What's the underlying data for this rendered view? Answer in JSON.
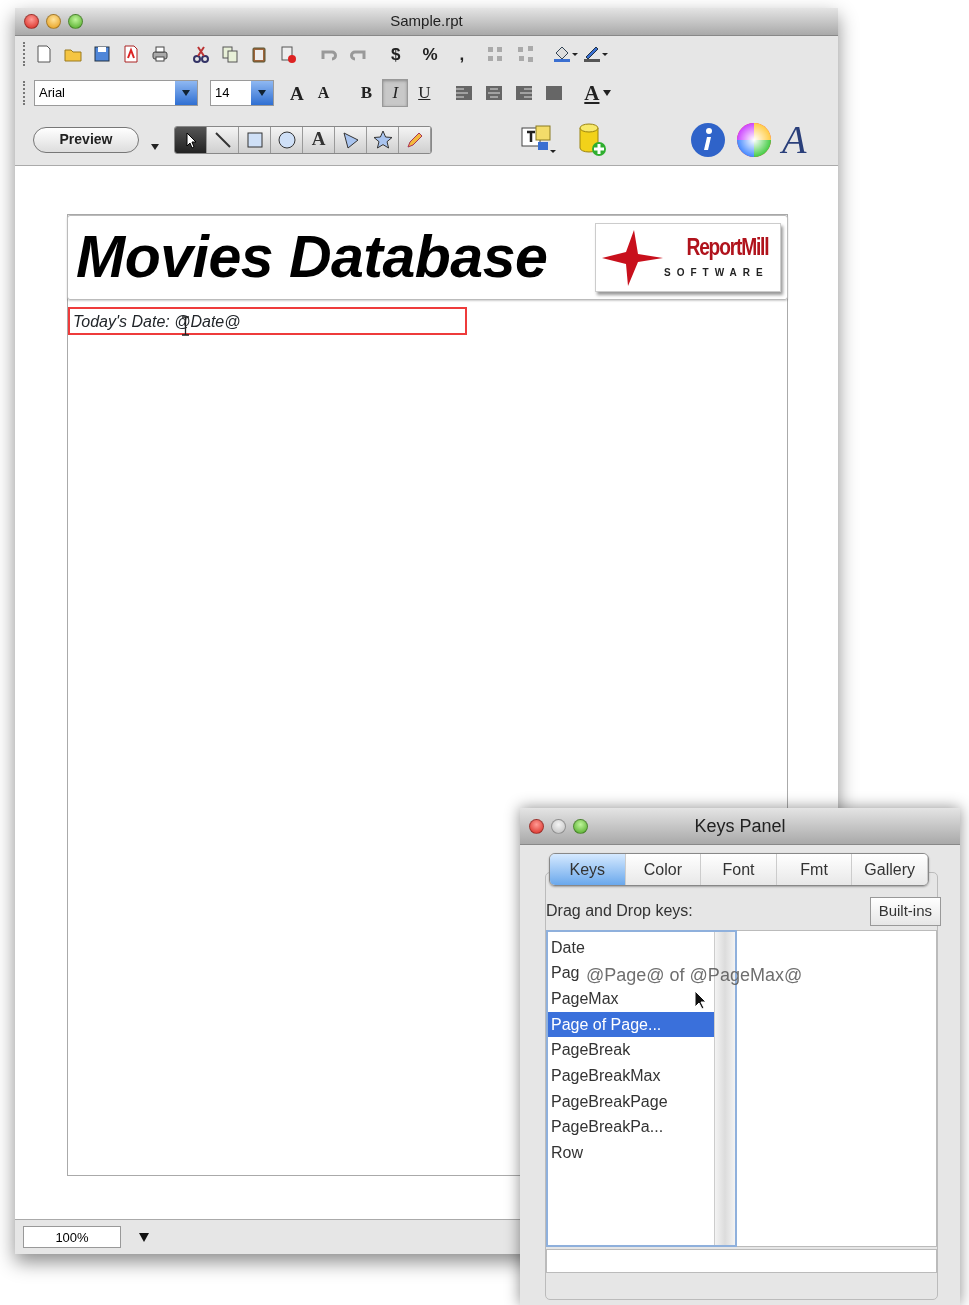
{
  "window": {
    "title": "Sample.rpt"
  },
  "toolbar": {
    "number_formats": [
      {
        "label": "$"
      },
      {
        "label": "%"
      },
      {
        "label": ","
      }
    ],
    "font": {
      "value": "Arial"
    },
    "font_size": {
      "value": "14"
    },
    "size_buttons": [
      {
        "label": "A"
      },
      {
        "label": "A"
      }
    ],
    "styles": [
      {
        "label": "B",
        "kind": "bold",
        "selected": false
      },
      {
        "label": "I",
        "kind": "italic",
        "selected": true
      },
      {
        "label": "U",
        "kind": "underline",
        "selected": false
      }
    ],
    "text_color_button": "A",
    "preview_button": "Preview",
    "tools": [
      {
        "kind": "select",
        "selected": true
      },
      {
        "kind": "line",
        "selected": false
      },
      {
        "kind": "rect",
        "selected": false
      },
      {
        "kind": "oval",
        "selected": false
      },
      {
        "kind": "text",
        "label": "A",
        "selected": false
      },
      {
        "kind": "polygon",
        "selected": false
      },
      {
        "kind": "star",
        "selected": false
      },
      {
        "kind": "pencil",
        "selected": false
      }
    ],
    "font_panel_button": "A"
  },
  "document": {
    "title": "Movies Database",
    "logo": {
      "name": "ReportMill",
      "tagline": "SOFTWARE"
    },
    "date_text": "Today's Date: @Date@",
    "date_selected": true
  },
  "status_bar": {
    "zoom": "100%"
  },
  "keys_panel": {
    "title": "Keys Panel",
    "tabs": [
      {
        "label": "Keys",
        "selected": true
      },
      {
        "label": "Color",
        "selected": false
      },
      {
        "label": "Font",
        "selected": false
      },
      {
        "label": "Fmt",
        "selected": false
      },
      {
        "label": "Gallery",
        "selected": false
      }
    ],
    "label": "Drag and Drop keys:",
    "builtins_button": "Built-ins",
    "keys": [
      {
        "label": "Date",
        "selected": false
      },
      {
        "label": "Pag",
        "selected": false
      },
      {
        "label": "PageMax",
        "selected": false
      },
      {
        "label": "Page of Page...",
        "selected": true
      },
      {
        "label": "PageBreak",
        "selected": false
      },
      {
        "label": "PageBreakMax",
        "selected": false
      },
      {
        "label": "PageBreakPage",
        "selected": false
      },
      {
        "label": "PageBreakPa...",
        "selected": false
      },
      {
        "label": "Row",
        "selected": false
      }
    ],
    "drag_text": "@Page@ of @PageMax@"
  }
}
